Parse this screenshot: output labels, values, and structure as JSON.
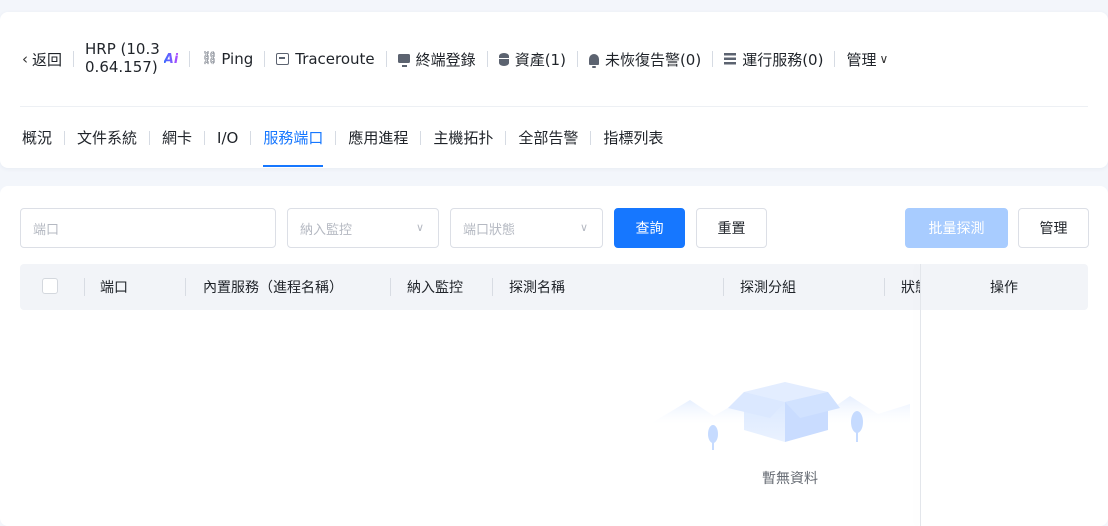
{
  "toolbar": {
    "back_label": "返回",
    "host_line1": "HRP (10.3",
    "host_line2": "0.64.157)",
    "ai_badge": "Ai",
    "ping_label": "Ping",
    "traceroute_label": "Traceroute",
    "terminal_login_label": "終端登錄",
    "assets_label": "資產(1)",
    "unresolved_alerts_label": "未恢復告警(0)",
    "running_services_label": "運行服務(0)",
    "manage_label": "管理"
  },
  "tabs": [
    {
      "label": "概況"
    },
    {
      "label": "文件系統"
    },
    {
      "label": "網卡"
    },
    {
      "label": "I/O"
    },
    {
      "label": "服務端口"
    },
    {
      "label": "應用進程"
    },
    {
      "label": "主機拓扑"
    },
    {
      "label": "全部告警"
    },
    {
      "label": "指標列表"
    }
  ],
  "active_tab": "服務端口",
  "filters": {
    "port_placeholder": "端口",
    "monitor_placeholder": "納入監控",
    "status_placeholder": "端口狀態",
    "query_label": "查詢",
    "reset_label": "重置",
    "batch_probe_label": "批量探測",
    "manage_label": "管理"
  },
  "table": {
    "columns": [
      "端口",
      "內置服務（進程名稱）",
      "納入監控",
      "探測名稱",
      "探測分組",
      "狀態",
      "操作"
    ],
    "rows": []
  },
  "empty": {
    "label": "暫無資料"
  },
  "colors": {
    "accent": "#1677ff",
    "disabled_accent": "#a8ccff",
    "page_bg": "#f3f6fb"
  }
}
